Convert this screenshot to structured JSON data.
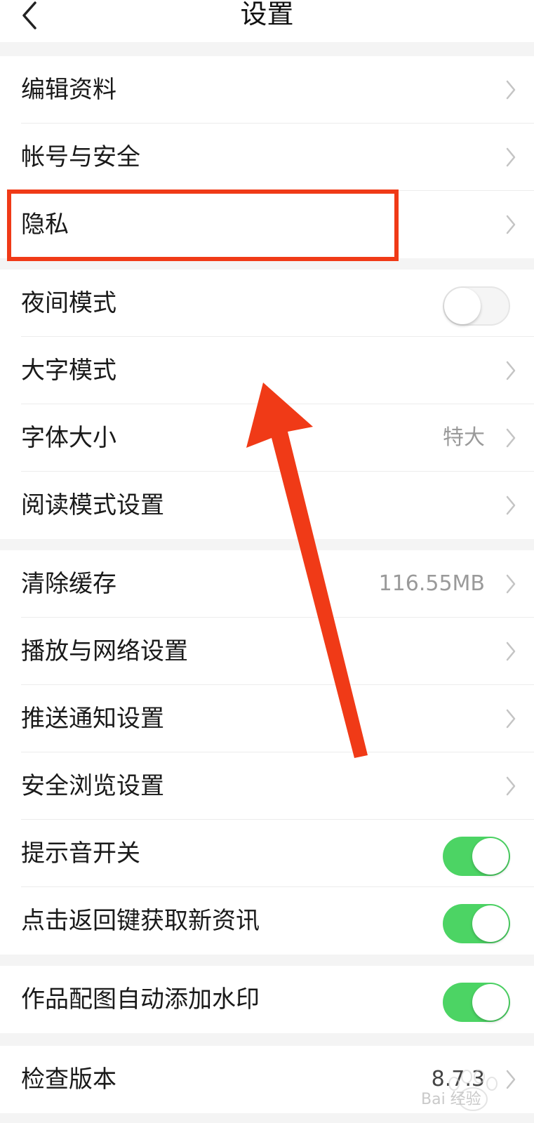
{
  "header": {
    "title": "设置",
    "back_icon": "chevron-left-icon"
  },
  "groups": [
    {
      "items": [
        {
          "label": "编辑资料",
          "control": "chevron"
        },
        {
          "label": "帐号与安全",
          "control": "chevron"
        },
        {
          "label": "隐私",
          "control": "chevron"
        }
      ]
    },
    {
      "items": [
        {
          "label": "夜间模式",
          "control": "toggle",
          "on": false
        },
        {
          "label": "大字模式",
          "control": "chevron"
        },
        {
          "label": "字体大小",
          "value": "特大",
          "control": "chevron"
        },
        {
          "label": "阅读模式设置",
          "control": "chevron"
        }
      ]
    },
    {
      "items": [
        {
          "label": "清除缓存",
          "value": "116.55MB",
          "control": "chevron"
        },
        {
          "label": "播放与网络设置",
          "control": "chevron"
        },
        {
          "label": "推送通知设置",
          "control": "chevron"
        },
        {
          "label": "安全浏览设置",
          "control": "chevron"
        },
        {
          "label": "提示音开关",
          "control": "toggle",
          "on": true
        },
        {
          "label": "点击返回键获取新资讯",
          "control": "toggle",
          "on": true
        }
      ]
    },
    {
      "items": [
        {
          "label": "作品配图自动添加水印",
          "control": "toggle",
          "on": true
        }
      ]
    },
    {
      "items": [
        {
          "label": "检查版本",
          "value": "8.7.3",
          "control": "chevron"
        }
      ]
    }
  ],
  "annotations": {
    "highlight_target": "隐私",
    "highlight_color": "#f03a17",
    "arrow_color": "#f03a17"
  },
  "watermark": {
    "text": "Bai 经验",
    "icon": "baidu-paw-icon"
  },
  "colors": {
    "toggle_on": "#4cd464",
    "background": "#f4f4f4",
    "value_text": "#9a9a9a"
  }
}
